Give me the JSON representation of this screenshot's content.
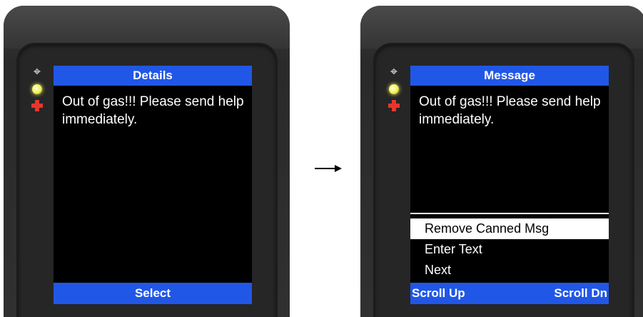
{
  "left_device": {
    "title": "Details",
    "message": "Out of gas!!!  Please send help immediately.",
    "softkey": "Select"
  },
  "right_device": {
    "title": "Message",
    "message": "Out of gas!!!  Please send help immediately.",
    "menu": [
      {
        "label": "Remove Canned Msg",
        "selected": true
      },
      {
        "label": "Enter Text",
        "selected": false
      },
      {
        "label": "Next",
        "selected": false
      }
    ],
    "softkey_left": "Scroll Up",
    "softkey_right": "Scroll Dn"
  },
  "indicators": {
    "icons": [
      "target-icon",
      "yellow-led-icon",
      "red-cross-icon"
    ]
  },
  "colors": {
    "title_bar": "#2157e6",
    "screen": "#000000",
    "housing": "#2e2e2e",
    "led_yellow": "#f2f256",
    "led_red": "#e8352c"
  }
}
